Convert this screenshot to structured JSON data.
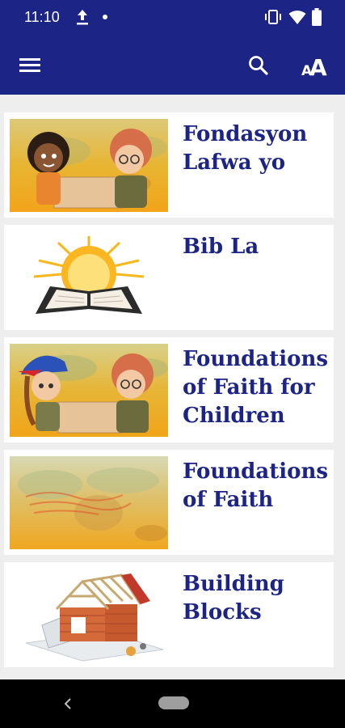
{
  "status_bar": {
    "time": "11:10",
    "icons": [
      "upload-icon",
      "notification-dot-icon",
      "vibrate-icon",
      "wifi-icon",
      "battery-icon"
    ]
  },
  "app_bar": {
    "background_color": "#1c2586",
    "menu_icon": "hamburger-menu-icon",
    "search_icon": "search-icon",
    "text_size_icon": "text-size-icon"
  },
  "books": [
    {
      "title": "Fondasyon Lafwa yo",
      "thumbnail": "children-with-map-image"
    },
    {
      "title": "Bib La",
      "thumbnail": "bible-with-sunrise-image"
    },
    {
      "title": "Foundations of Faith for Children",
      "thumbnail": "children-with-map-image"
    },
    {
      "title": "Foundations of Faith",
      "thumbnail": "faded-world-map-image"
    },
    {
      "title": "Building Blocks",
      "thumbnail": "house-construction-image"
    }
  ],
  "nav_bar": {
    "back_icon": "back-icon",
    "home_icon": "home-pill-icon"
  }
}
